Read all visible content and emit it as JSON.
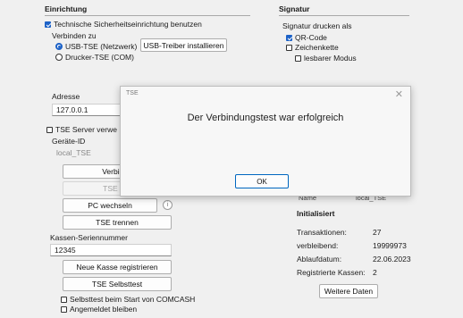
{
  "einrichtung": {
    "title": "Einrichtung",
    "tse_checkbox_label": "Technische Sicherheitseinrichtung benutzen",
    "verbinden_label": "Verbinden zu",
    "radio_usb": "USB-TSE (Netzwerk)",
    "radio_drucker": "Drucker-TSE (COM)",
    "usb_driver_button": "USB-Treiber installieren",
    "adresse_label": "Adresse",
    "adresse_value": "127.0.0.1",
    "tse_server_label": "TSE Server verwe",
    "geraete_id_label": "Geräte-ID",
    "geraete_id_value": "local_TSE",
    "verbindungstest_button": "Verbindu",
    "tse_init_button": "TSE initi",
    "pc_wechseln_button": "PC wechseln",
    "tse_trennen_button": "TSE trennen",
    "kassen_serien_label": "Kassen-Seriennummer",
    "kassen_serien_value": "12345",
    "neue_kasse_button": "Neue Kasse registrieren",
    "selbsttest_button": "TSE Selbsttest",
    "selbsttest_start_label": "Selbsttest beim Start von COMCASH",
    "angemeldet_label": "Angemeldet bleiben"
  },
  "signatur": {
    "title": "Signatur",
    "drucken_label": "Signatur drucken als",
    "qr_label": "QR-Code",
    "zeichenkette_label": "Zeichenkette",
    "lesbar_label": "lesbarer Modus"
  },
  "status": {
    "partial_name_label": "Name",
    "partial_name_value": "local_TSE",
    "heading": "Initialisiert",
    "rows": [
      {
        "label": "Transaktionen:",
        "value": "27"
      },
      {
        "label": "verbleibend:",
        "value": "19999973"
      },
      {
        "label": "Ablaufdatum:",
        "value": "22.06.2023"
      },
      {
        "label": "Registrierte Kassen:",
        "value": "2"
      }
    ],
    "weitere_daten_button": "Weitere Daten"
  },
  "dialog": {
    "title": "TSE",
    "close": "✕",
    "message": "Der Verbindungstest war erfolgreich",
    "ok_button": "OK"
  }
}
